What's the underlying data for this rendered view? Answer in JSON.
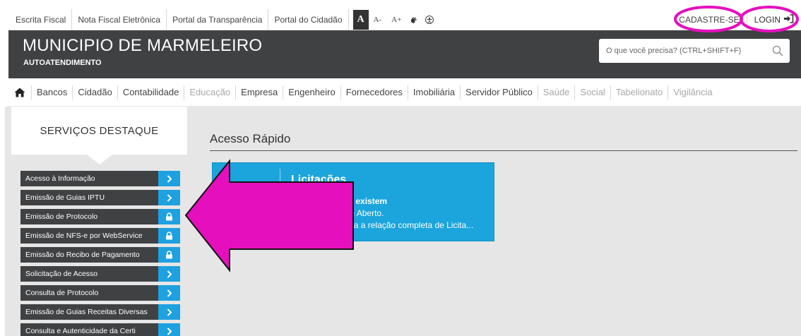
{
  "topbar": {
    "links": [
      "Escrita Fiscal",
      "Nota Fiscal Eletrônica",
      "Portal da Transparência",
      "Portal do Cidadão"
    ],
    "font_normal": "A",
    "font_decrease": "A-",
    "font_increase": "A+",
    "cadastre_label": "CADASTRE-SE",
    "login_label": "LOGIN"
  },
  "header": {
    "title": "MUNICIPIO DE MARMELEIRO",
    "subtitle": "AUTOATENDIMENTO",
    "search_placeholder": "O que você precisa? (CTRL+SHIFT+F)"
  },
  "nav": {
    "items": [
      {
        "label": "Bancos",
        "disabled": false
      },
      {
        "label": "Cidadão",
        "disabled": false
      },
      {
        "label": "Contabilidade",
        "disabled": false
      },
      {
        "label": "Educação",
        "disabled": true
      },
      {
        "label": "Empresa",
        "disabled": false
      },
      {
        "label": "Engenheiro",
        "disabled": false
      },
      {
        "label": "Fornecedores",
        "disabled": false
      },
      {
        "label": "Imobiliária",
        "disabled": false
      },
      {
        "label": "Servidor Público",
        "disabled": false
      },
      {
        "label": "Saúde",
        "disabled": true
      },
      {
        "label": "Social",
        "disabled": true
      },
      {
        "label": "Tabelionato",
        "disabled": true
      },
      {
        "label": "Vigilância",
        "disabled": true
      }
    ]
  },
  "sidebar": {
    "title": "SERVIÇOS DESTAQUE",
    "items": [
      {
        "label": "Acesso à Informação",
        "icon": "chevron-right"
      },
      {
        "label": "Emissão de Guias IPTU",
        "icon": "chevron-right"
      },
      {
        "label": "Emissão de Protocolo",
        "icon": "lock"
      },
      {
        "label": "Emissão de NFS-e por WebService",
        "icon": "lock"
      },
      {
        "label": "Emissão do Recibo de Pagamento",
        "icon": "lock"
      },
      {
        "label": "Solicitação de Acesso",
        "icon": "chevron-right"
      },
      {
        "label": "Consulta de Protocolo",
        "icon": "chevron-right"
      },
      {
        "label": "Emissão de Guias Receitas Diversas",
        "icon": "chevron-right"
      },
      {
        "label": "Consulta e Autenticidade da Certi",
        "icon": "chevron-right"
      }
    ]
  },
  "main": {
    "section_title": "Acesso Rápido",
    "card": {
      "title": "Licitações",
      "line1": "No ano de 2022 existem",
      "line2": "28 Licitações em Aberto.",
      "line3": "Clique aqui e veja a relação completa de Licita..."
    }
  },
  "colors": {
    "header_bg": "#3f4143",
    "accent_blue": "#1ba5dc",
    "annotation_magenta": "#e60fbe"
  }
}
